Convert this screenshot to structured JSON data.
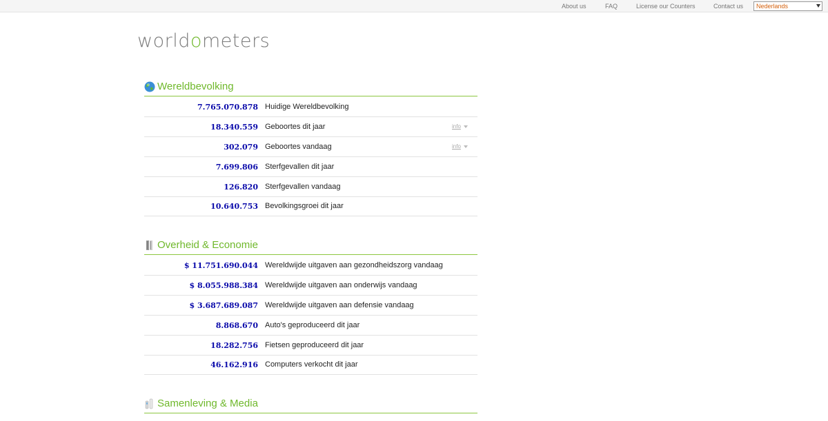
{
  "topnav": {
    "about": "About us",
    "faq": "FAQ",
    "license": "License our Counters",
    "contact": "Contact us",
    "language": "Nederlands"
  },
  "logo": {
    "part1": "world",
    "part2": "o",
    "part3": "meters"
  },
  "sections": [
    {
      "title": "Wereldbevolking",
      "icon": "globe-icon",
      "rows": [
        {
          "value": "7.765.070.878",
          "label": "Huidige Wereldbevolking",
          "info": ""
        },
        {
          "value": "18.340.559",
          "label": "Geboortes dit jaar",
          "info": "info"
        },
        {
          "value": "302.079",
          "label": "Geboortes vandaag",
          "info": "info"
        },
        {
          "value": "7.699.806",
          "label": "Sterfgevallen dit jaar",
          "info": ""
        },
        {
          "value": "126.820",
          "label": "Sterfgevallen vandaag",
          "info": ""
        },
        {
          "value": "10.640.753",
          "label": "Bevolkingsgroei dit jaar",
          "info": ""
        }
      ]
    },
    {
      "title": "Overheid & Economie",
      "icon": "building-icon",
      "rows": [
        {
          "value": "$ 11.751.690.044",
          "label": "Wereldwijde uitgaven aan gezondheidszorg vandaag"
        },
        {
          "value": "$ 8.055.988.384",
          "label": "Wereldwijde uitgaven aan onderwijs vandaag"
        },
        {
          "value": "$ 3.687.689.087",
          "label": "Wereldwijde uitgaven aan defensie vandaag"
        },
        {
          "value": "8.868.670",
          "label": "Auto's geproduceerd dit jaar"
        },
        {
          "value": "18.282.756",
          "label": "Fietsen geproduceerd dit jaar"
        },
        {
          "value": "46.162.916",
          "label": "Computers verkocht dit jaar"
        }
      ]
    },
    {
      "title": "Samenleving & Media",
      "icon": "media-icon",
      "rows": []
    }
  ],
  "colors": {
    "accent": "#6fb82b",
    "number": "#0a0aaa",
    "lang": "#d4600c"
  }
}
